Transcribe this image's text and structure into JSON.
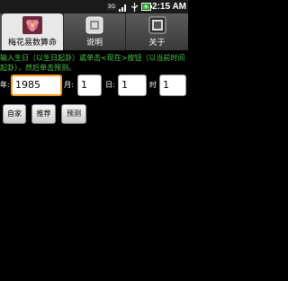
{
  "status_bar": {
    "network": "3G",
    "time": "2:15 AM"
  },
  "tabs": [
    {
      "label": "梅花易数算命",
      "icon": "flower-icon",
      "active": true
    },
    {
      "label": "说明",
      "icon": "info-icon",
      "active": false
    },
    {
      "label": "关于",
      "icon": "about-icon",
      "active": false
    }
  ],
  "instructions": "输入生日（以生日起卦）或单击<现在>按钮（以当前时间起卦），然后单击预测。",
  "birth_form": {
    "year_label": "年:",
    "year_value": "1985",
    "month_label": "月:",
    "month_value": "1",
    "day_label": "日:",
    "day_value": "1",
    "hour_label": "时",
    "hour_value": "1"
  },
  "buttons": {
    "self_label": "自家",
    "recommend_label": "推荐",
    "predict_label": "预测"
  },
  "colors": {
    "accent": "#f39a1e",
    "instruction_text": "#4cc44c",
    "tab_active": "#e8e8e8",
    "tab_inactive": "#4d4d4d"
  }
}
